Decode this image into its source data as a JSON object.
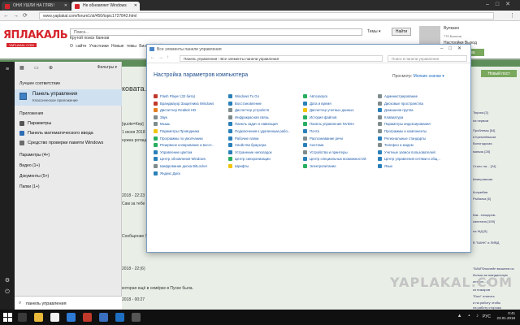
{
  "browser": {
    "tabs": [
      {
        "label": "ОНИ УШЛИ НА ГЛЯБ!",
        "active": false
      },
      {
        "label": "Не обновляет Windows",
        "active": true
      }
    ],
    "url": "www.yaplakal.com/forum1/st/450/topic1727842.html"
  },
  "site": {
    "logo": "ЯПЛАКАЛЬ",
    "logo_sub": "YAPLAKAL.COM",
    "search_placeholder": "Поиск...",
    "tagline": "Крутой поиск баянов",
    "links": "О сайте   Участники   Новые темы   Бизнесфутбол",
    "themes_label": "Темы ▾",
    "find_button": "Найти",
    "user_name": "Вулкано",
    "user_badge": "770 Баллов",
    "user_links": "Настройки   Выход",
    "new_topic_button": "Новая тема",
    "new_post_button": "Новый пост",
    "watermark": "YAPLAKAL.COM",
    "post_title": "ковата.",
    "post_line": "которая ещё в семёрке в Пуске была.",
    "right_items": [
      "Тюряга [3]",
      "на первом",
      "Проблемы [54]",
      "в Кремлёвском",
      "Вологодская",
      "маньяк [28]",
      "Стало ли... [24]",
      "Кемеровская",
      "Колумбия",
      "Рыбалка [6]",
      "Как...танцоров-",
      "капитана [159]",
      "на ЖД [5]",
      "В \"БАНК\" и ЛИВД",
      "\"БАМ\"блокчейн вышлем из",
      "больш за скандальную",
      "интерн... [5]",
      "из пожаров",
      "\"Ешо\" платить",
      "и на работу чтобы",
      "на работу сторожа"
    ],
    "mid_lines": [
      "[quote=Кер]",
      "1 июня 2018 - 22:09",
      "нужна ротация",
      "2018 - 22:23",
      "Сам за тебе",
      "Сообщение Soft",
      "2018 - 22:(6)",
      "2018 - 00:27"
    ]
  },
  "control_panel": {
    "window_title": "Все элементы панели управления",
    "path": "Панель управления  ›  Все элементы панели управления",
    "search_placeholder": "Поиск в панели управления",
    "heading": "Настройка параметров компьютера",
    "view_label": "Просмотр:",
    "view_value": "Мелкие значки ▾",
    "columns": [
      [
        {
          "label": "Flash Player (32 бита)",
          "color": "#c0392b"
        },
        {
          "label": "Брандмауэр Защитника Windows",
          "color": "#c0392b"
        },
        {
          "label": "Диспетчер Realtek HD",
          "color": "#e67e22"
        },
        {
          "label": "Звук",
          "color": "#7f8c8d"
        },
        {
          "label": "Мышь",
          "color": "#7f8c8d"
        },
        {
          "label": "Параметры Проводника",
          "color": "#f1c40f"
        },
        {
          "label": "Программы по умолчанию",
          "color": "#27ae60"
        },
        {
          "label": "Резервное копирование и восст...",
          "color": "#27ae60"
        },
        {
          "label": "Управление цветом",
          "color": "#2980b9"
        },
        {
          "label": "Центр обновления Windows",
          "color": "#2980b9"
        },
        {
          "label": "Шифрование диска BitLocker",
          "color": "#7f8c8d"
        },
        {
          "label": "Яндекс.Диск",
          "color": "#2980b9"
        }
      ],
      [
        {
          "label": "Windows To Go",
          "color": "#2980b9"
        },
        {
          "label": "Восстановление",
          "color": "#2980b9"
        },
        {
          "label": "Диспетчер устройств",
          "color": "#7f8c8d"
        },
        {
          "label": "Инфракрасная связь",
          "color": "#7f8c8d"
        },
        {
          "label": "Панель задач и навигация",
          "color": "#2980b9"
        },
        {
          "label": "Подключения к удаленным рабо...",
          "color": "#2980b9"
        },
        {
          "label": "Рабочие папки",
          "color": "#2980b9"
        },
        {
          "label": "Свойства браузера",
          "color": "#2980b9"
        },
        {
          "label": "Устранение неполадок",
          "color": "#2980b9"
        },
        {
          "label": "Центр синхронизации",
          "color": "#27ae60"
        },
        {
          "label": "Шрифты",
          "color": "#f1c40f"
        }
      ],
      [
        {
          "label": "Автозапуск",
          "color": "#27ae60"
        },
        {
          "label": "Дата и время",
          "color": "#2980b9"
        },
        {
          "label": "Диспетчер учетных данных",
          "color": "#f1c40f"
        },
        {
          "label": "История файлов",
          "color": "#27ae60"
        },
        {
          "label": "Панель управления NVIDIA",
          "color": "#27ae60"
        },
        {
          "label": "Почта",
          "color": "#2980b9"
        },
        {
          "label": "Распознавание речи",
          "color": "#7f8c8d"
        },
        {
          "label": "Система",
          "color": "#2980b9"
        },
        {
          "label": "Устройства и принтеры",
          "color": "#7f8c8d"
        },
        {
          "label": "Центр специальных возможностей",
          "color": "#2980b9"
        },
        {
          "label": "Электропитание",
          "color": "#27ae60"
        }
      ],
      [
        {
          "label": "Администрирование",
          "color": "#7f8c8d"
        },
        {
          "label": "Дисковые пространства",
          "color": "#7f8c8d"
        },
        {
          "label": "Домашняя группа",
          "color": "#2980b9"
        },
        {
          "label": "Клавиатура",
          "color": "#7f8c8d"
        },
        {
          "label": "Параметры индексирования",
          "color": "#7f8c8d"
        },
        {
          "label": "Программы и компоненты",
          "color": "#7f8c8d"
        },
        {
          "label": "Региональные стандарты",
          "color": "#2980b9"
        },
        {
          "label": "Телефон и модем",
          "color": "#7f8c8d"
        },
        {
          "label": "Учетные записи пользователей",
          "color": "#2980b9"
        },
        {
          "label": "Центр управления сетями и общ...",
          "color": "#2980b9"
        },
        {
          "label": "Язык",
          "color": "#2980b9"
        }
      ]
    ]
  },
  "start_menu": {
    "filters_label": "Фильтры ▾",
    "best_match_heading": "Лучшее соответствие",
    "best_match_title": "Панель управления",
    "best_match_subtitle": "Классическое приложение",
    "apps_heading": "Приложения",
    "apps": [
      {
        "label": "Параметры",
        "color": "#555555"
      },
      {
        "label": "Панель математического ввода",
        "color": "#2e6db4"
      },
      {
        "label": "Средство проверки памяти Windows",
        "color": "#6b6b6b"
      }
    ],
    "categories": [
      "Параметры (4+)",
      "Видео (1+)",
      "Документы (5+)",
      "Папки (1+)"
    ],
    "search_text": "панель управления"
  },
  "taskbar": {
    "lang": "РУС",
    "time": "0:41",
    "date": "23.01.2018"
  }
}
